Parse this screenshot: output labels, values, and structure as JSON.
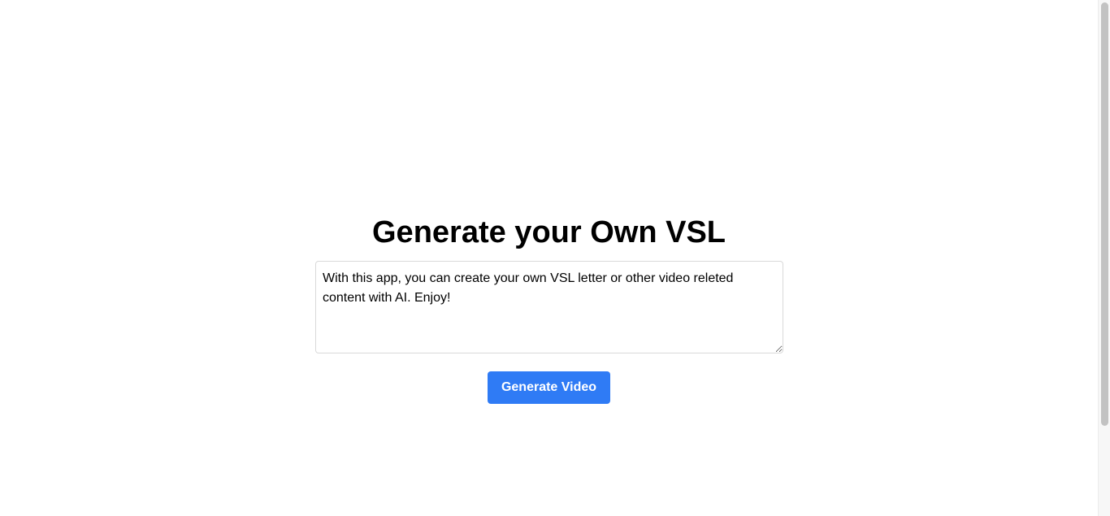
{
  "main": {
    "title": "Generate your Own VSL",
    "prompt_value": "With this app, you can create your own VSL letter or other video releted content with AI. Enjoy!",
    "generate_button_label": "Generate Video"
  },
  "colors": {
    "button_background": "#2f7bf5",
    "button_text": "#ffffff",
    "input_border": "#d9d9d9"
  }
}
